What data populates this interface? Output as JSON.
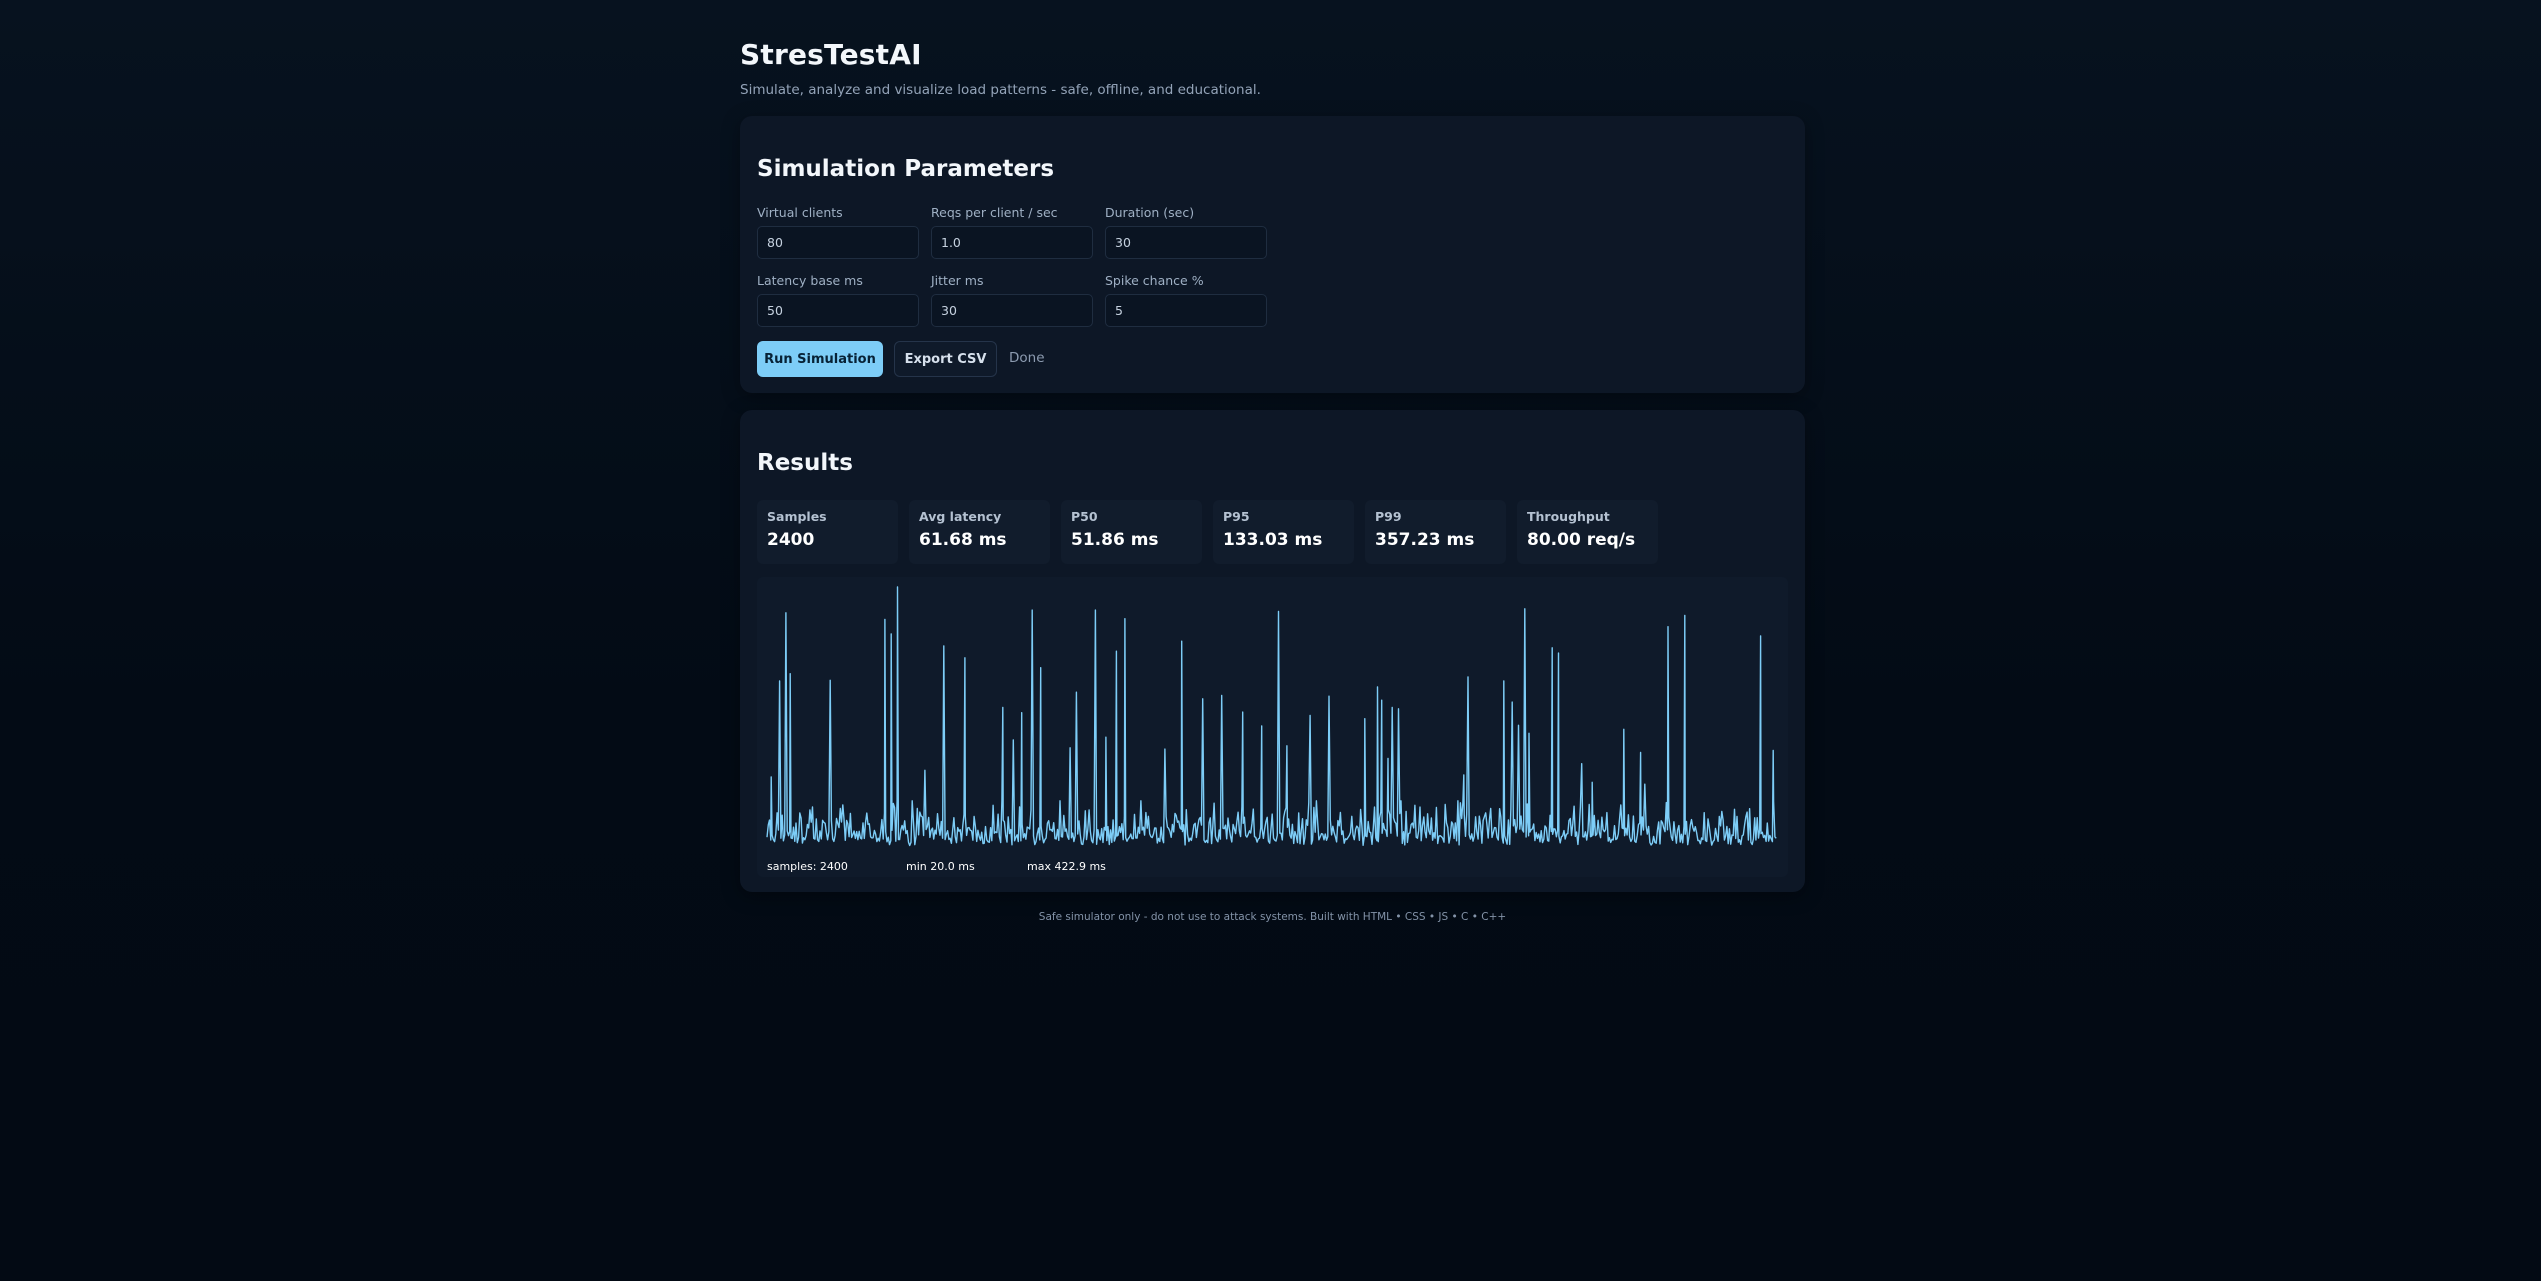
{
  "app": {
    "title": "StresTestAI",
    "subtitle": "Simulate, analyze and visualize load patterns - safe, offline, and educational."
  },
  "params": {
    "heading": "Simulation Parameters",
    "fields": [
      {
        "label": "Virtual clients",
        "value": "80"
      },
      {
        "label": "Reqs per client / sec",
        "value": "1.0"
      },
      {
        "label": "Duration (sec)",
        "value": "30"
      },
      {
        "label": "Latency base ms",
        "value": "50"
      },
      {
        "label": "Jitter ms",
        "value": "30"
      },
      {
        "label": "Spike chance %",
        "value": "5"
      }
    ],
    "run_label": "Run Simulation",
    "export_label": "Export CSV",
    "status": "Done"
  },
  "results": {
    "heading": "Results",
    "stats": [
      {
        "label": "Samples",
        "value": "2400"
      },
      {
        "label": "Avg latency",
        "value": "61.68 ms"
      },
      {
        "label": "P50",
        "value": "51.86 ms"
      },
      {
        "label": "P95",
        "value": "133.03 ms"
      },
      {
        "label": "P99",
        "value": "357.23 ms"
      },
      {
        "label": "Throughput",
        "value": "80.00 req/s"
      }
    ]
  },
  "chart_data": {
    "type": "line",
    "series_color": "#7dcdf7",
    "samples": 2400,
    "min_ms": 20.0,
    "max_ms": 422.9,
    "labels": {
      "samples": "samples: 2400",
      "min": "min 20.0 ms",
      "max": "max 422.9 ms"
    },
    "baseline_range_ms": [
      20,
      100
    ],
    "spikes": [
      {
        "sample": 10,
        "latency": 136
      },
      {
        "sample": 30,
        "latency": 281
      },
      {
        "sample": 45,
        "latency": 384
      },
      {
        "sample": 55,
        "latency": 292
      },
      {
        "sample": 150,
        "latency": 282
      },
      {
        "sample": 280,
        "latency": 374
      },
      {
        "sample": 295,
        "latency": 352
      },
      {
        "sample": 310,
        "latency": 422.9
      },
      {
        "sample": 375,
        "latency": 146
      },
      {
        "sample": 420,
        "latency": 334
      },
      {
        "sample": 470,
        "latency": 316
      },
      {
        "sample": 560,
        "latency": 241
      },
      {
        "sample": 585,
        "latency": 192
      },
      {
        "sample": 605,
        "latency": 233
      },
      {
        "sample": 630,
        "latency": 388
      },
      {
        "sample": 650,
        "latency": 301
      },
      {
        "sample": 720,
        "latency": 180
      },
      {
        "sample": 735,
        "latency": 264
      },
      {
        "sample": 780,
        "latency": 388
      },
      {
        "sample": 805,
        "latency": 196
      },
      {
        "sample": 830,
        "latency": 326
      },
      {
        "sample": 850,
        "latency": 375
      },
      {
        "sample": 945,
        "latency": 178
      },
      {
        "sample": 985,
        "latency": 341
      },
      {
        "sample": 1035,
        "latency": 254
      },
      {
        "sample": 1080,
        "latency": 259
      },
      {
        "sample": 1130,
        "latency": 234
      },
      {
        "sample": 1175,
        "latency": 213
      },
      {
        "sample": 1215,
        "latency": 386
      },
      {
        "sample": 1235,
        "latency": 183
      },
      {
        "sample": 1290,
        "latency": 229
      },
      {
        "sample": 1335,
        "latency": 258
      },
      {
        "sample": 1420,
        "latency": 224
      },
      {
        "sample": 1450,
        "latency": 272
      },
      {
        "sample": 1460,
        "latency": 252
      },
      {
        "sample": 1475,
        "latency": 164
      },
      {
        "sample": 1485,
        "latency": 241
      },
      {
        "sample": 1500,
        "latency": 239
      },
      {
        "sample": 1655,
        "latency": 139
      },
      {
        "sample": 1665,
        "latency": 287
      },
      {
        "sample": 1750,
        "latency": 281
      },
      {
        "sample": 1770,
        "latency": 249
      },
      {
        "sample": 1785,
        "latency": 214
      },
      {
        "sample": 1800,
        "latency": 390
      },
      {
        "sample": 1810,
        "latency": 202
      },
      {
        "sample": 1865,
        "latency": 331
      },
      {
        "sample": 1880,
        "latency": 323
      },
      {
        "sample": 1935,
        "latency": 156
      },
      {
        "sample": 1960,
        "latency": 128
      },
      {
        "sample": 2035,
        "latency": 208
      },
      {
        "sample": 2075,
        "latency": 173
      },
      {
        "sample": 2085,
        "latency": 125
      },
      {
        "sample": 2140,
        "latency": 363
      },
      {
        "sample": 2180,
        "latency": 380
      },
      {
        "sample": 2360,
        "latency": 349
      },
      {
        "sample": 2390,
        "latency": 176
      }
    ]
  },
  "footer": "Safe simulator only - do not use to attack systems. Built with HTML • CSS • JS • C • C++"
}
